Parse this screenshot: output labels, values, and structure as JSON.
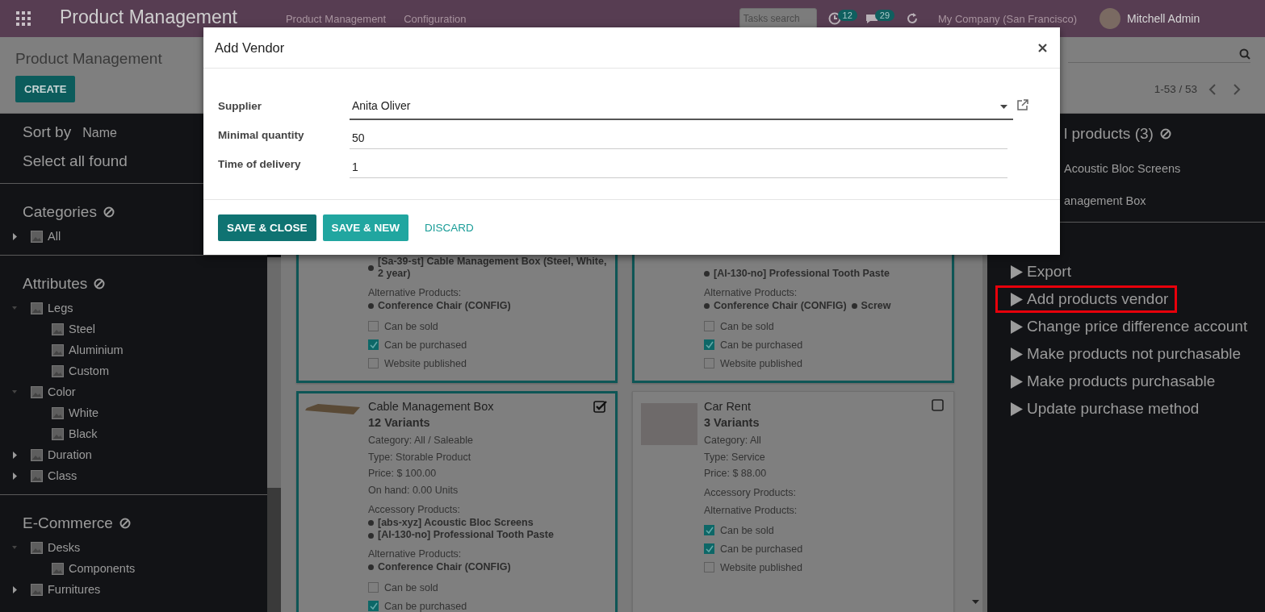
{
  "topbar": {
    "app_title": "Product Management",
    "menu": [
      "Product Management",
      "Configuration"
    ],
    "search_placeholder": "Tasks search",
    "activity_count": "12",
    "message_count": "29",
    "company": "My Company (San Francisco)",
    "user": "Mitchell Admin"
  },
  "control_panel": {
    "breadcrumb": "Product Management",
    "create_button": "CREATE",
    "pager": "1-53 / 53"
  },
  "sidebar": {
    "sort_label": "Sort by",
    "sort_value": "Name",
    "select_all": "Select all found",
    "sections": [
      {
        "title": "Categories",
        "items": [
          {
            "label": "All",
            "expanded": false
          }
        ]
      },
      {
        "title": "Attributes",
        "items": [
          {
            "label": "Legs",
            "expanded": true,
            "children": [
              {
                "label": "Steel"
              },
              {
                "label": "Aluminium"
              },
              {
                "label": "Custom"
              }
            ]
          },
          {
            "label": "Color",
            "expanded": true,
            "children": [
              {
                "label": "White"
              },
              {
                "label": "Black"
              }
            ]
          },
          {
            "label": "Duration",
            "expanded": false
          },
          {
            "label": "Class",
            "expanded": false
          }
        ]
      },
      {
        "title": "E-Commerce",
        "items": [
          {
            "label": "Desks",
            "expanded": true,
            "children": [
              {
                "label": "Components"
              }
            ]
          },
          {
            "label": "Furnitures",
            "expanded": false
          }
        ]
      }
    ]
  },
  "cards": [
    {
      "selected": true,
      "accessories": [
        "[Sa-39-st] Cable Management Box (Steel, White, 2 year)"
      ],
      "alternative_label": "Alternative Products:",
      "alternatives": [
        "Conference Chair (CONFIG)"
      ],
      "flags": [
        {
          "label": "Can be sold",
          "checked": false
        },
        {
          "label": "Can be purchased",
          "checked": true
        },
        {
          "label": "Website published",
          "checked": false
        }
      ]
    },
    {
      "selected": true,
      "accessories": [
        "[Al-130-no] Professional Tooth Paste"
      ],
      "alternative_label": "Alternative Products:",
      "alternatives": [
        "Conference Chair (CONFIG)",
        "Screw"
      ],
      "flags": [
        {
          "label": "Can be sold",
          "checked": false
        },
        {
          "label": "Can be purchased",
          "checked": true
        },
        {
          "label": "Website published",
          "checked": false
        }
      ]
    },
    {
      "selected": true,
      "title": "Cable Management Box",
      "variants": "12 Variants",
      "details": [
        "Category: All / Saleable",
        "Type: Storable Product",
        "Price: $ 100.00",
        "On hand: 0.00 Units"
      ],
      "accessory_label": "Accessory Products:",
      "accessories": [
        "[abs-xyz] Acoustic Bloc Screens",
        "[Al-130-no] Professional Tooth Paste"
      ],
      "alternative_label": "Alternative Products:",
      "alternatives": [
        "Conference Chair (CONFIG)"
      ],
      "flags": [
        {
          "label": "Can be sold",
          "checked": false
        },
        {
          "label": "Can be purchased",
          "checked": true
        }
      ]
    },
    {
      "selected": false,
      "title": "Car Rent",
      "variants": "3 Variants",
      "details": [
        "Category: All",
        "Type: Service",
        "Price: $ 88.00"
      ],
      "accessory_label": "Accessory Products:",
      "alternative_label": "Alternative Products:",
      "flags": [
        {
          "label": "Can be sold",
          "checked": true
        },
        {
          "label": "Can be purchased",
          "checked": true
        },
        {
          "label": "Website published",
          "checked": false
        }
      ]
    }
  ],
  "right_panel": {
    "selection_title": "l products (3)",
    "selection_items": [
      "Acoustic Bloc Screens",
      "anagement Box"
    ],
    "actions": [
      {
        "label": "Export",
        "highlighted": false
      },
      {
        "label": "Add products vendor",
        "highlighted": true
      },
      {
        "label": "Change price difference account",
        "highlighted": false
      },
      {
        "label": "Make products not purchasable",
        "highlighted": false
      },
      {
        "label": "Make products purchasable",
        "highlighted": false
      },
      {
        "label": "Update purchase method",
        "highlighted": false
      }
    ]
  },
  "dialog": {
    "title": "Add Vendor",
    "fields": [
      {
        "kind": "dropdown",
        "label": "Supplier",
        "value": "Anita Oliver"
      },
      {
        "kind": "text",
        "label": "Minimal quantity",
        "value": "50"
      },
      {
        "kind": "text",
        "label": "Time of delivery",
        "value": "1"
      }
    ],
    "buttons": [
      {
        "kind": "primary",
        "label": "SAVE & CLOSE"
      },
      {
        "kind": "secondary",
        "label": "SAVE & NEW"
      },
      {
        "kind": "link",
        "label": "DISCARD"
      }
    ]
  }
}
